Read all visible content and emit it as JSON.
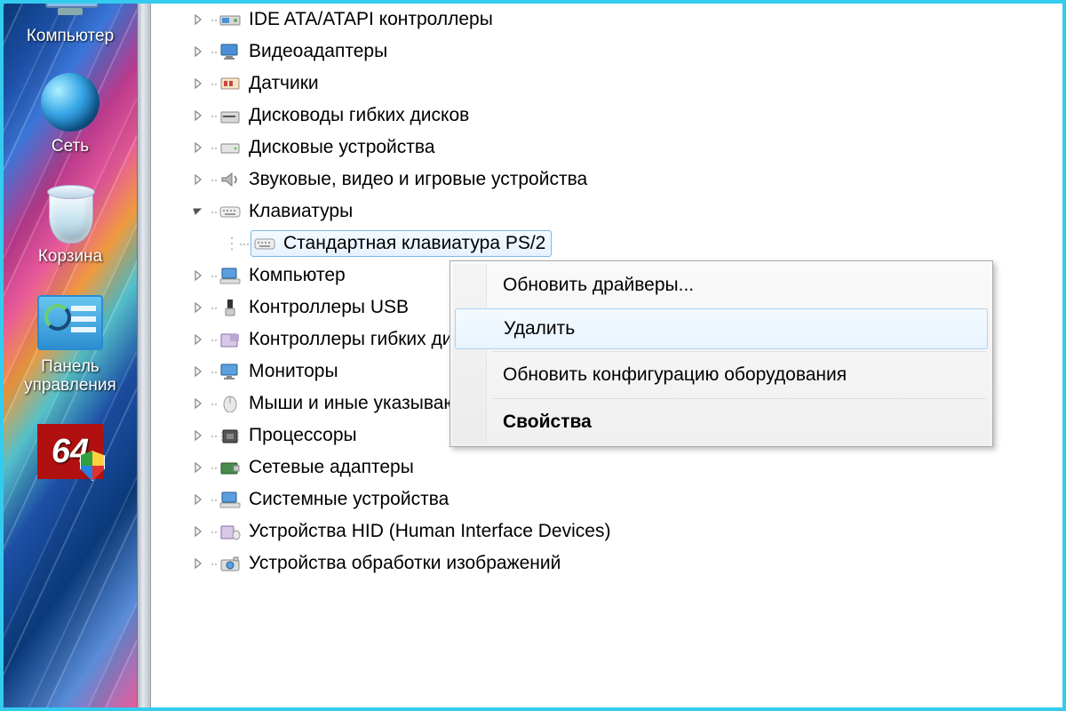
{
  "desktop": {
    "icons": [
      {
        "id": "computer",
        "label": "Компьютер"
      },
      {
        "id": "network",
        "label": "Сеть"
      },
      {
        "id": "recyclebin",
        "label": "Корзина"
      },
      {
        "id": "cpl",
        "label": "Панель\nуправления"
      },
      {
        "id": "app64",
        "label": ""
      }
    ]
  },
  "device_tree": {
    "categories": [
      {
        "icon": "ide",
        "label": "IDE ATA/ATAPI контроллеры",
        "expanded": false
      },
      {
        "icon": "display",
        "label": "Видеоадаптеры",
        "expanded": false
      },
      {
        "icon": "sensor",
        "label": "Датчики",
        "expanded": false
      },
      {
        "icon": "floppy",
        "label": "Дисководы гибких дисков",
        "expanded": false
      },
      {
        "icon": "disk",
        "label": "Дисковые устройства",
        "expanded": false
      },
      {
        "icon": "sound",
        "label": "Звуковые, видео и игровые устройства",
        "expanded": false
      },
      {
        "icon": "keyboard",
        "label": "Клавиатуры",
        "expanded": true,
        "children": [
          {
            "icon": "keyboard",
            "label": "Стандартная клавиатура PS/2",
            "selected": true
          }
        ]
      },
      {
        "icon": "computer",
        "label": "Компьютер",
        "expanded": false
      },
      {
        "icon": "usb",
        "label": "Контроллеры USB",
        "expanded": false
      },
      {
        "icon": "fdc",
        "label": "Контроллеры гибких дисков",
        "expanded": false
      },
      {
        "icon": "monitor",
        "label": "Мониторы",
        "expanded": false
      },
      {
        "icon": "mouse",
        "label": "Мыши и иные указывающие устройства",
        "expanded": false
      },
      {
        "icon": "cpu",
        "label": "Процессоры",
        "expanded": false
      },
      {
        "icon": "nic",
        "label": "Сетевые адаптеры",
        "expanded": false
      },
      {
        "icon": "system",
        "label": "Системные устройства",
        "expanded": false
      },
      {
        "icon": "hid",
        "label": "Устройства HID (Human Interface Devices)",
        "expanded": false
      },
      {
        "icon": "imaging",
        "label": "Устройства обработки изображений",
        "expanded": false
      }
    ]
  },
  "context_menu": {
    "items": [
      {
        "label": "Обновить драйверы...",
        "hover": false
      },
      {
        "label": "Удалить",
        "hover": true
      },
      {
        "sep": true
      },
      {
        "label": "Обновить конфигурацию оборудования",
        "hover": false
      },
      {
        "sep": true
      },
      {
        "label": "Свойства",
        "bold": true,
        "hover": false
      }
    ]
  }
}
